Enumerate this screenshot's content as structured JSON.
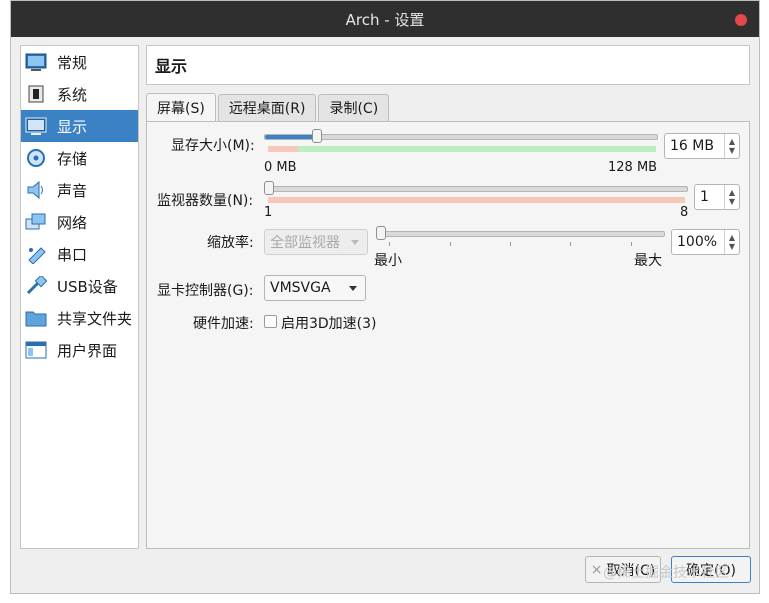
{
  "window": {
    "title": "Arch - 设置"
  },
  "sidebar": {
    "items": [
      {
        "label": "常规",
        "icon": "general-icon"
      },
      {
        "label": "系统",
        "icon": "chip-icon"
      },
      {
        "label": "显示",
        "icon": "monitor-icon",
        "active": true
      },
      {
        "label": "存储",
        "icon": "disk-icon"
      },
      {
        "label": "声音",
        "icon": "speaker-icon"
      },
      {
        "label": "网络",
        "icon": "network-icon"
      },
      {
        "label": "串口",
        "icon": "serial-icon"
      },
      {
        "label": "USB设备",
        "icon": "usb-icon"
      },
      {
        "label": "共享文件夹",
        "icon": "folder-icon"
      },
      {
        "label": "用户界面",
        "icon": "ui-icon"
      }
    ]
  },
  "header": {
    "title": "显示"
  },
  "tabs": [
    {
      "label": "屏幕(S)",
      "active": true
    },
    {
      "label": "远程桌面(R)"
    },
    {
      "label": "录制(C)"
    }
  ],
  "screen": {
    "video_memory": {
      "label": "显存大小(M):",
      "value": "16 MB",
      "min_label": "0 MB",
      "max_label": "128 MB",
      "fraction": 0.125
    },
    "monitor_count": {
      "label": "监视器数量(N):",
      "value": "1",
      "min_label": "1",
      "max_label": "8",
      "fraction": 0
    },
    "scale_factor": {
      "label": "缩放率:",
      "combo": "全部监视器",
      "value": "100%",
      "min_label": "最小",
      "max_label": "最大",
      "fraction": 0
    },
    "graphics_controller": {
      "label": "显卡控制器(G):",
      "value": "VMSVGA"
    },
    "acceleration": {
      "label": "硬件加速:",
      "checkbox_label": "启用3D加速(3)",
      "checked": false
    }
  },
  "footer": {
    "cancel": "取消(C)",
    "ok": "确定(O)"
  },
  "watermark": "@稀土掘金技术社区",
  "colors": {
    "accent": "#3a82c4",
    "titlebar": "#2f2f2f",
    "close": "#e0484c",
    "green_band": "#bdeebd",
    "red_band": "#f5c8b7"
  }
}
